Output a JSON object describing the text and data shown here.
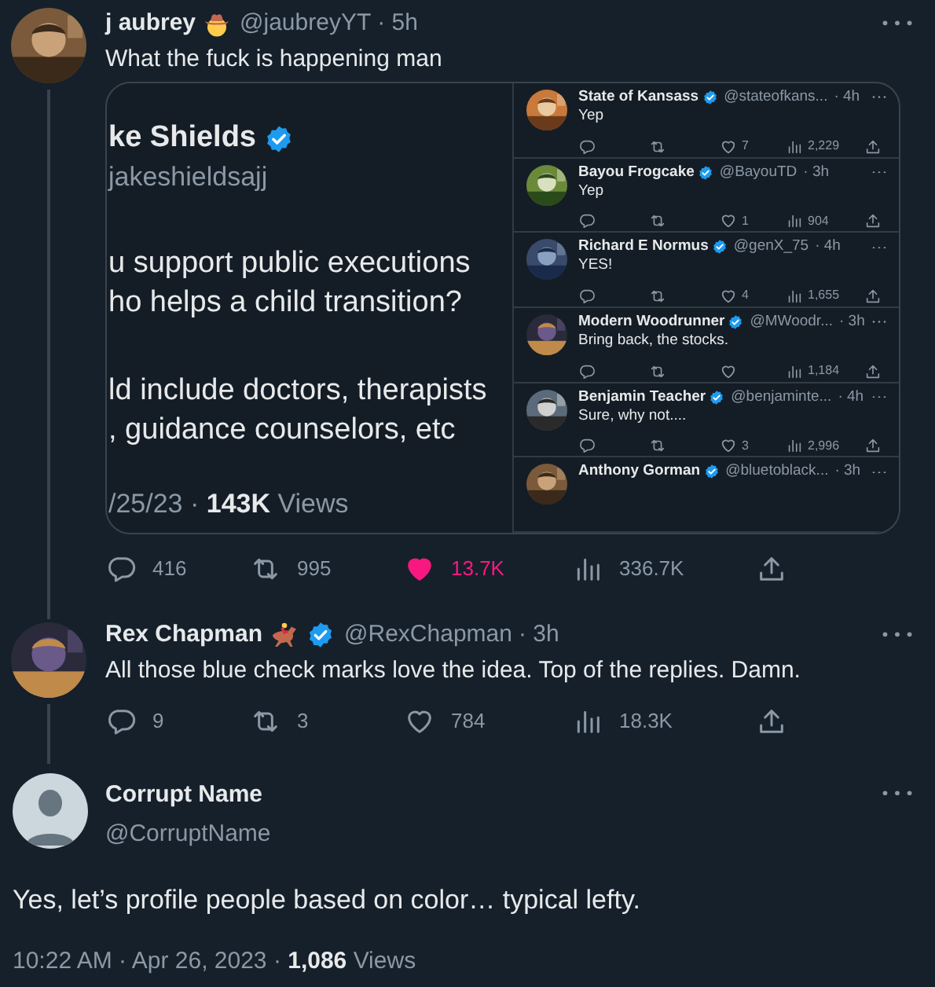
{
  "tweet": {
    "name": "j aubrey",
    "badge": {
      "kind": "cowboy"
    },
    "verified": false,
    "handle": "@jaubreyYT",
    "time": "· 5h",
    "text": "What the fuck is happening man",
    "media": {
      "quoted": {
        "name": "ke Shields",
        "verified": true,
        "handle": "jakeshieldsajj",
        "paragraphs": [
          "u support public executions\nho helps a child transition?",
          "ld include doctors, therapists\n, guidance counselors, etc"
        ],
        "footer": "/25/23 · **143K** Views"
      },
      "replies": [
        {
          "name": "State of Kansass",
          "verified": true,
          "handle": "@stateofkans...",
          "time": "· 4h",
          "text": "Yep",
          "likes": "7",
          "views": "2,229"
        },
        {
          "name": "Bayou Frogcake",
          "verified": true,
          "handle": "@BayouTD",
          "time": "· 3h",
          "text": "Yep",
          "likes": "1",
          "views": "904"
        },
        {
          "name": "Richard E Normus",
          "verified": true,
          "handle": "@genX_75",
          "time": "· 4h",
          "text": "YES!",
          "likes": "4",
          "views": "1,655"
        },
        {
          "name": "Modern Woodrunner",
          "verified": true,
          "handle": "@MWoodr...",
          "time": "· 3h",
          "text": "Bring back, the stocks.",
          "views": "1,184"
        },
        {
          "name": "Benjamin Teacher",
          "verified": true,
          "handle": "@benjaminte...",
          "time": "· 4h",
          "text": "Sure, why not....",
          "likes": "3",
          "views": "2,996"
        },
        {
          "name": "Anthony Gorman",
          "verified": true,
          "handle": "@bluetoblack...",
          "time": "· 3h"
        }
      ]
    },
    "stats": {
      "replies": "416",
      "retweets": "995",
      "likes": "13.7K",
      "liked": true,
      "views": "336.7K"
    }
  },
  "reply": {
    "name": "Rex Chapman",
    "badge": {
      "kind": "horse"
    },
    "verified": true,
    "handle": "@RexChapman",
    "time": "· 3h",
    "text": "All those blue check marks love the idea. Top of the replies. Damn.",
    "stats": {
      "replies": "9",
      "retweets": "3",
      "likes": "784",
      "liked": false,
      "views": "18.3K"
    }
  },
  "main_tweet": {
    "name": "Corrupt Name",
    "handle": "@CorruptName",
    "text": "Yes, let’s profile people based on color… typical lefty.",
    "footer": "10:22 AM · Apr 26, 2023 · **1,086** Views"
  }
}
